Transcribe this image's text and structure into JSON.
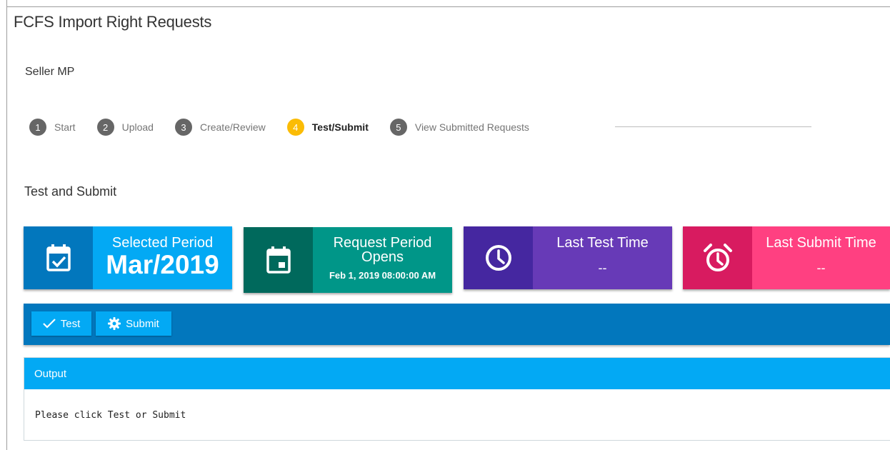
{
  "page": {
    "title": "FCFS Import Right Requests",
    "subtitle": "Seller MP"
  },
  "stepper": {
    "active_index": 4,
    "active_color": "#fbbc05",
    "steps": [
      {
        "num": "1",
        "label": "Start"
      },
      {
        "num": "2",
        "label": "Upload"
      },
      {
        "num": "3",
        "label": "Create/Review"
      },
      {
        "num": "4",
        "label": "Test/Submit"
      },
      {
        "num": "5",
        "label": "View Submitted Requests"
      }
    ]
  },
  "section": {
    "title": "Test and Submit"
  },
  "cards": [
    {
      "label": "Selected Period",
      "value": "Mar/2019",
      "icon": "calendar-check-icon",
      "colors": {
        "icon_bg": "#0277bd",
        "body_bg": "#03a9f4"
      }
    },
    {
      "label": "Request Period Opens",
      "value": "Feb 1, 2019 08:00:00 AM",
      "icon": "calendar-event-icon",
      "colors": {
        "icon_bg": "#00695c",
        "body_bg": "#009688"
      }
    },
    {
      "label": "Last Test Time",
      "value": "--",
      "icon": "clock-icon",
      "colors": {
        "icon_bg": "#4527a0",
        "body_bg": "#673ab7"
      }
    },
    {
      "label": "Last Submit Time",
      "value": "--",
      "icon": "alarm-clock-icon",
      "colors": {
        "icon_bg": "#d81b60",
        "body_bg": "#ff4081"
      }
    }
  ],
  "toolbar": {
    "test_label": "Test",
    "test_icon": "checkmark-icon",
    "submit_label": "Submit",
    "submit_icon": "gear-icon",
    "bg_color": "#0277bd",
    "button_color": "#03a9f4"
  },
  "output": {
    "header": "Output",
    "text": "Please click Test or Submit",
    "header_color": "#03a9f4"
  }
}
